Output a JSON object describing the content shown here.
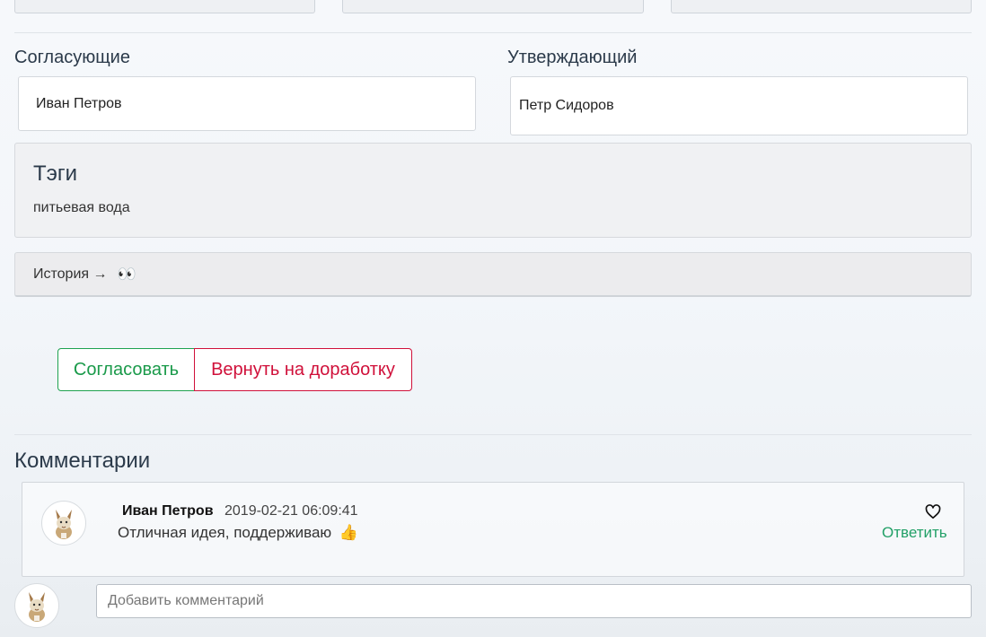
{
  "approvers": {
    "label": "Согласующие",
    "value": "Иван Петров"
  },
  "approver_final": {
    "label": "Утверждающий",
    "value": "Петр Сидоров"
  },
  "tags": {
    "title": "Тэги",
    "value": "питьевая вода"
  },
  "history": {
    "label": "История →",
    "icon": "eyes-icon",
    "emoji": "👀"
  },
  "actions": {
    "approve_label": "Согласовать",
    "return_label": "Вернуть на доработку",
    "approve_color": "#1fa250",
    "return_color": "#d0103a"
  },
  "comments": {
    "title": "Комментарии",
    "items": [
      {
        "author": "Иван Петров",
        "timestamp": "2019-02-21 06:09:41",
        "text": "Отличная идея, поддерживаю",
        "emoji": "👍",
        "reply_label": "Ответить"
      }
    ],
    "input_placeholder": "Добавить комментарий"
  }
}
